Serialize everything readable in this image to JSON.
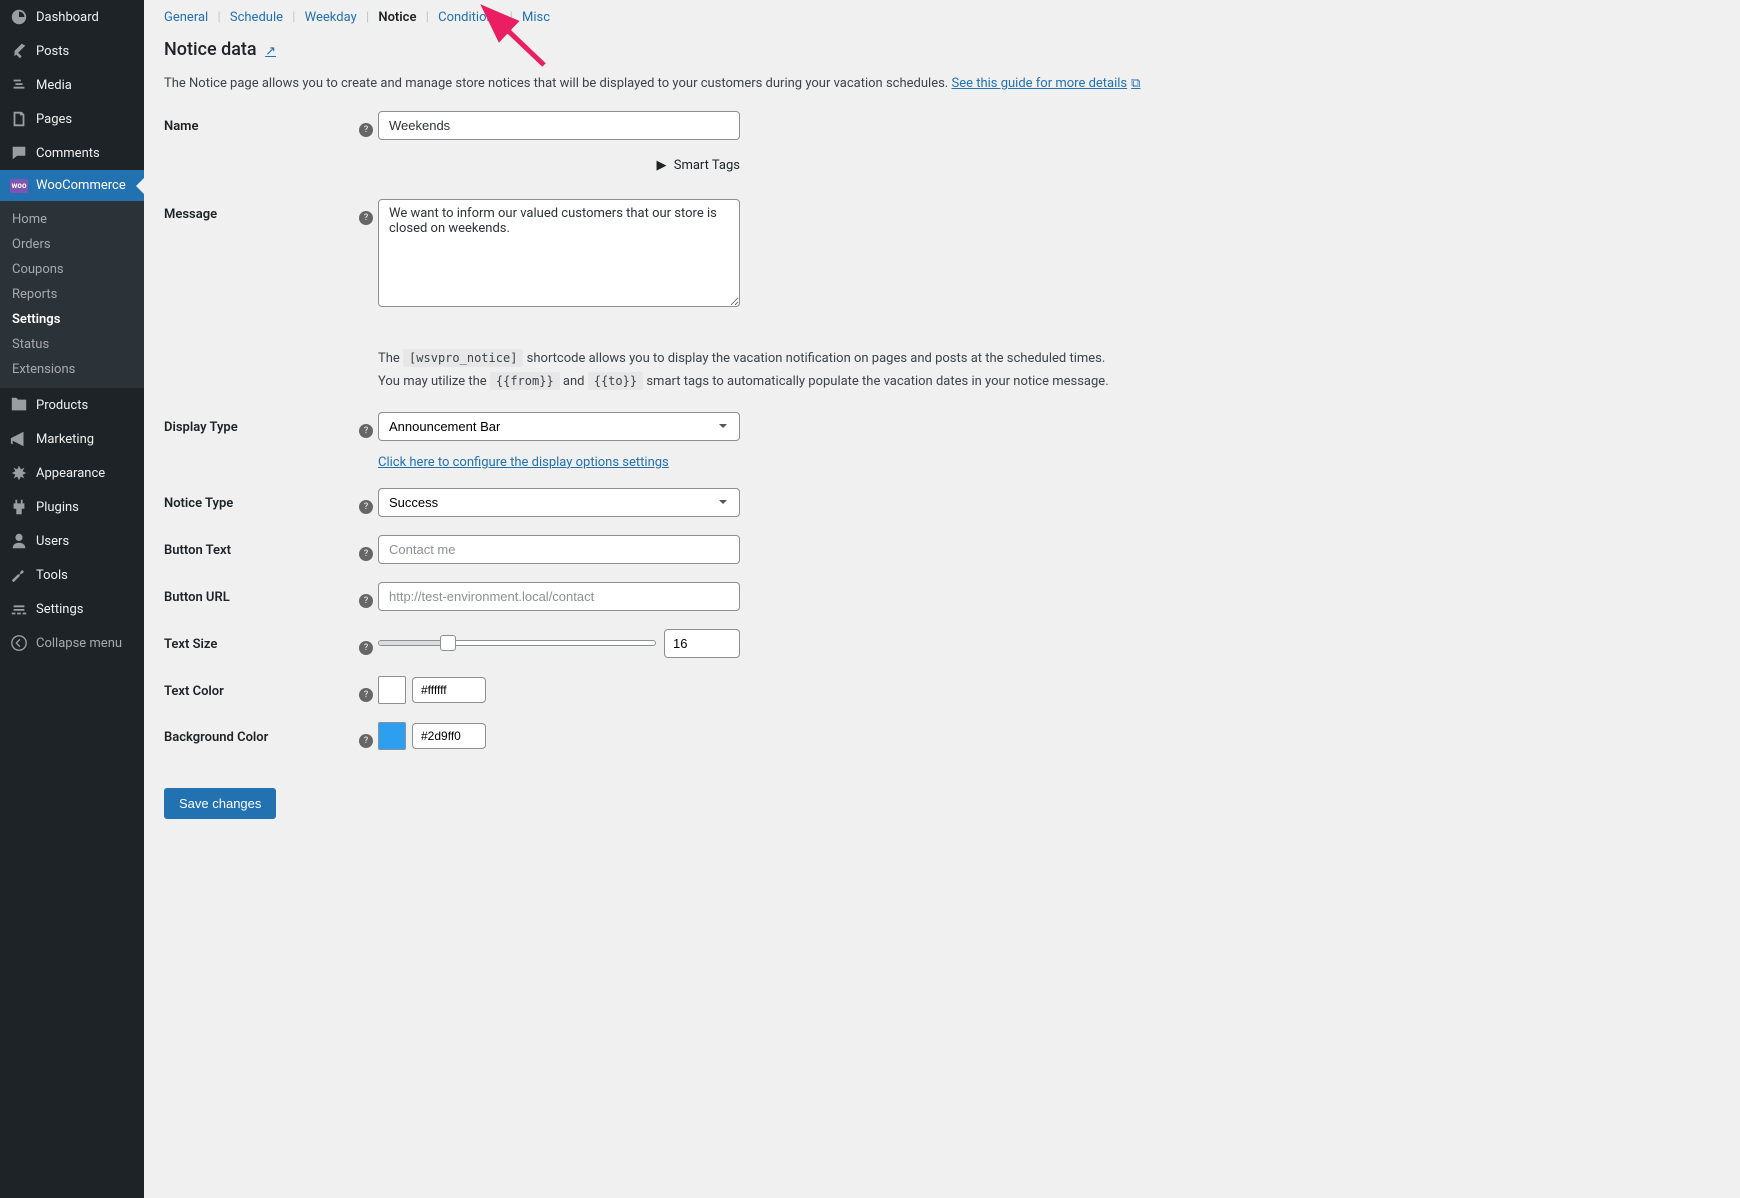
{
  "sidebar": {
    "dashboard": "Dashboard",
    "posts": "Posts",
    "media": "Media",
    "pages": "Pages",
    "comments": "Comments",
    "woocommerce": "WooCommerce",
    "submenu": {
      "home": "Home",
      "orders": "Orders",
      "coupons": "Coupons",
      "reports": "Reports",
      "settings": "Settings",
      "status": "Status",
      "extensions": "Extensions"
    },
    "products": "Products",
    "marketing": "Marketing",
    "appearance": "Appearance",
    "plugins": "Plugins",
    "users": "Users",
    "tools": "Tools",
    "settings2": "Settings",
    "collapse": "Collapse menu"
  },
  "tabs": {
    "general": "General",
    "schedule": "Schedule",
    "weekday": "Weekday",
    "notice": "Notice",
    "conditions": "Conditions",
    "misc": "Misc"
  },
  "page": {
    "title": "Notice data",
    "title_link": "↗",
    "description": "The Notice page allows you to create and manage store notices that will be displayed to your customers during your vacation schedules.",
    "guide_link": "See this guide for more details"
  },
  "form": {
    "name_label": "Name",
    "name_value": "Weekends",
    "smart_tags_label": "Smart Tags",
    "message_label": "Message",
    "message_value": "We want to inform our valued customers that our store is closed on weekends.",
    "shortcode_prefix": "The",
    "shortcode_code": "[wsvpro_notice]",
    "shortcode_suffix": "shortcode allows you to display the vacation notification on pages and posts at the scheduled times.",
    "smarttag_prefix": "You may utilize the",
    "smarttag_from": "{{from}}",
    "smarttag_and": "and",
    "smarttag_to": "{{to}}",
    "smarttag_suffix": "smart tags to automatically populate the vacation dates in your notice message.",
    "display_type_label": "Display Type",
    "display_type_value": "Announcement Bar",
    "config_link": "Click here to configure the display options settings",
    "notice_type_label": "Notice Type",
    "notice_type_value": "Success",
    "button_text_label": "Button Text",
    "button_text_placeholder": "Contact me",
    "button_url_label": "Button URL",
    "button_url_placeholder": "http://test-environment.local/contact",
    "text_size_label": "Text Size",
    "text_size_value": "16",
    "text_color_label": "Text Color",
    "text_color_value": "#ffffff",
    "bg_color_label": "Background Color",
    "bg_color_value": "#2d9ff0",
    "save_button": "Save changes"
  }
}
